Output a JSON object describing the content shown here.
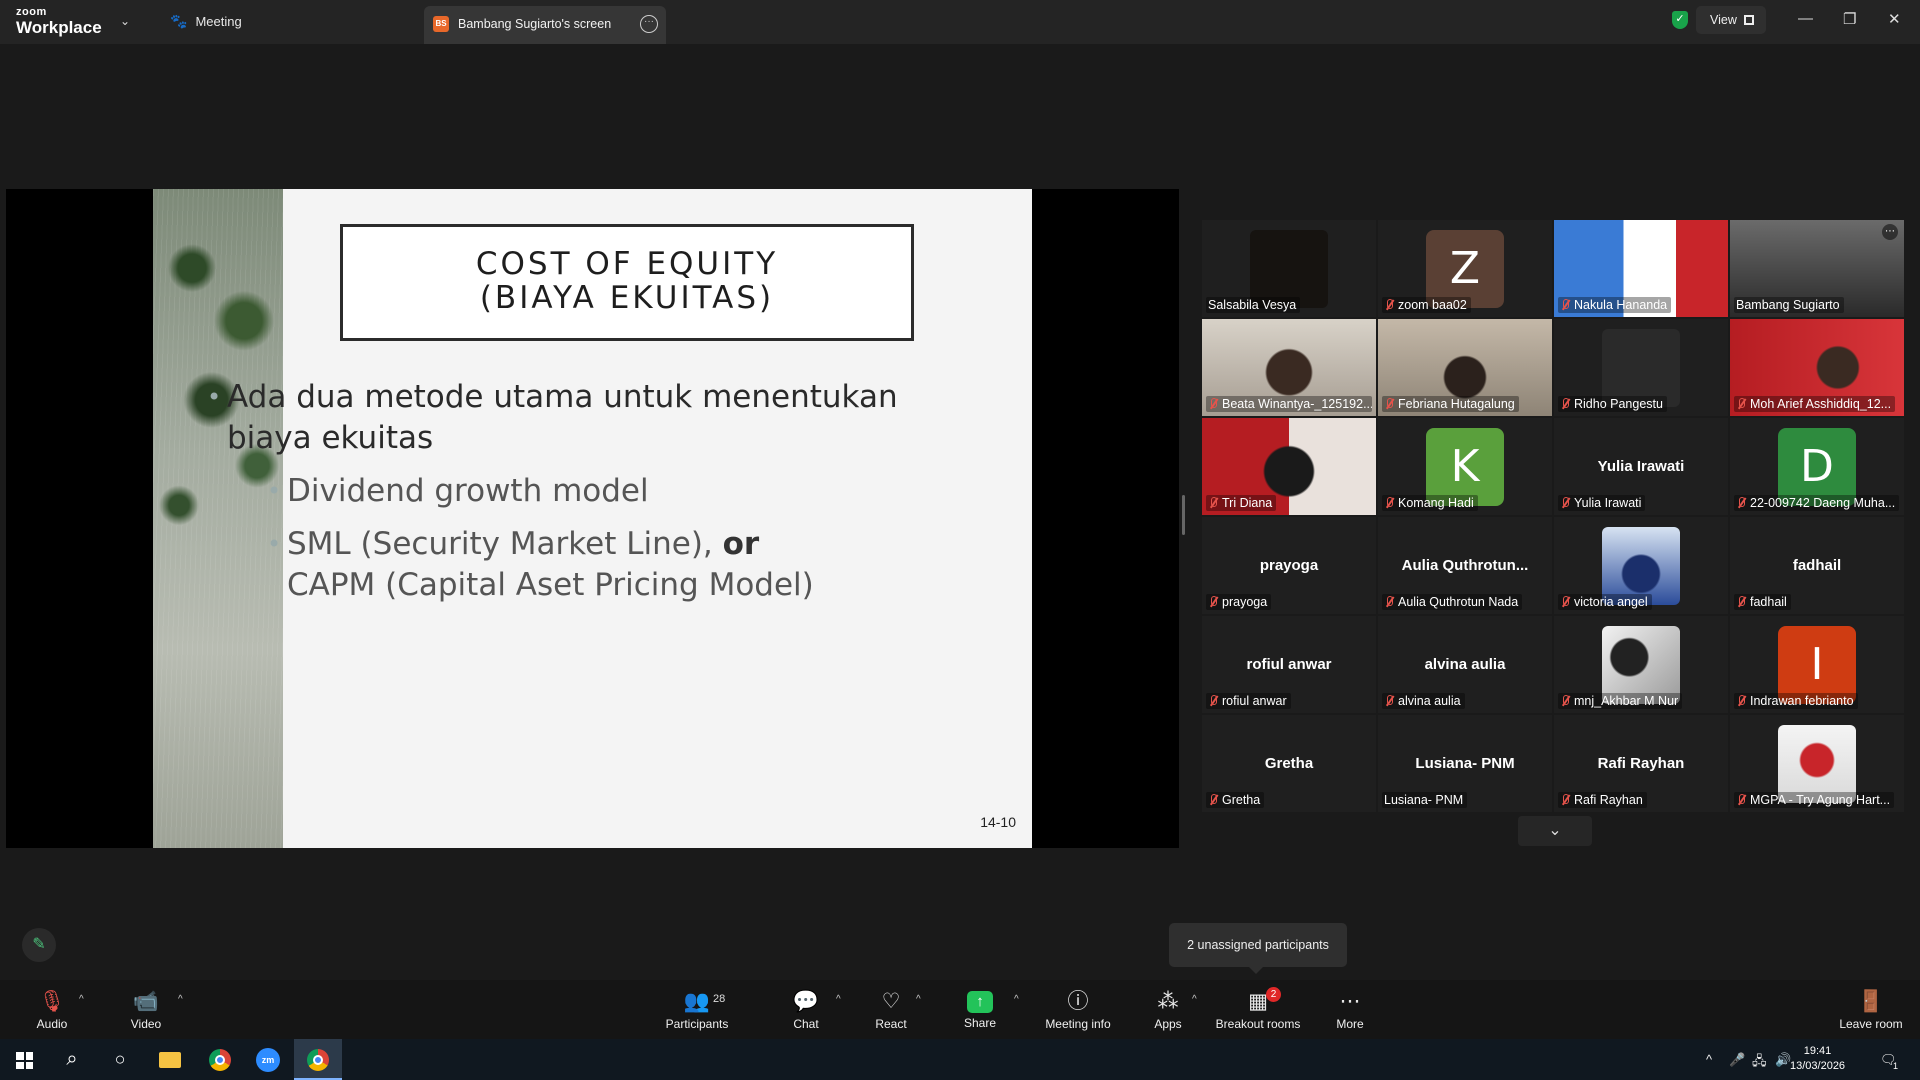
{
  "titlebar": {
    "logo_small": "zoom",
    "logo_big": "Workplace",
    "meeting_label": "Meeting",
    "tab_initials": "BS",
    "tab_title": "Bambang Sugiarto's screen",
    "view_label": "View",
    "shield_color": "#19a34a"
  },
  "slide": {
    "title_line1": "COST OF EQUITY",
    "title_line2": "(BIAYA EKUITAS)",
    "bullet_main": "Ada dua metode utama untuk menentukan biaya ekuitas",
    "sub1": "Dividend growth model",
    "sub2_part1": "SML (Security Market Line),",
    "sub2_bold": "or",
    "sub2_part2": "CAPM (Capital Aset Pricing Model)",
    "page_number": "14-10"
  },
  "participants": [
    {
      "label": "Salsabila Vesya",
      "muted": false,
      "kind": "dark"
    },
    {
      "label": "zoom baa02",
      "muted": true,
      "kind": "letter",
      "letter": "Z",
      "color": "#5a4034"
    },
    {
      "label": "Nakula Hananda",
      "muted": true,
      "kind": "photo"
    },
    {
      "label": "Bambang Sugiarto",
      "muted": false,
      "kind": "photo",
      "active": true
    },
    {
      "label": "Beata Winantya-_125192...",
      "muted": true,
      "kind": "photo"
    },
    {
      "label": "Febriana Hutagalung",
      "muted": true,
      "kind": "photo"
    },
    {
      "label": "Ridho Pangestu",
      "muted": true,
      "kind": "dark"
    },
    {
      "label": "Moh Arief Asshiddiq_12...",
      "muted": true,
      "kind": "photo"
    },
    {
      "label": "Tri Diana",
      "muted": true,
      "kind": "photo"
    },
    {
      "label": "Komang Hadi",
      "muted": true,
      "kind": "letter",
      "letter": "K",
      "color": "#5aa03c"
    },
    {
      "label": "Yulia Irawati",
      "muted": true,
      "kind": "name",
      "name": "Yulia Irawati"
    },
    {
      "label": "22-009742 Daeng Muha...",
      "muted": true,
      "kind": "letter",
      "letter": "D",
      "color": "#2e8b3e"
    },
    {
      "label": "prayoga",
      "muted": true,
      "kind": "name",
      "name": "prayoga"
    },
    {
      "label": "Aulia Quthrotun Nada",
      "muted": true,
      "kind": "name",
      "name": "Aulia  Quthrotun..."
    },
    {
      "label": "victoria angel",
      "muted": true,
      "kind": "thumb"
    },
    {
      "label": "fadhail",
      "muted": true,
      "kind": "name",
      "name": "fadhail"
    },
    {
      "label": "rofiul anwar",
      "muted": true,
      "kind": "name",
      "name": "rofiul anwar"
    },
    {
      "label": "alvina aulia",
      "muted": true,
      "kind": "name",
      "name": "alvina aulia"
    },
    {
      "label": "mnj_Akhbar M Nur",
      "muted": true,
      "kind": "thumb"
    },
    {
      "label": "Indrawan febrianto",
      "muted": true,
      "kind": "letter",
      "letter": "I",
      "color": "#cf3c12"
    },
    {
      "label": "Gretha",
      "muted": true,
      "kind": "name",
      "name": "Gretha"
    },
    {
      "label": "Lusiana- PNM",
      "muted": false,
      "kind": "name",
      "name": "Lusiana- PNM"
    },
    {
      "label": "Rafi Rayhan",
      "muted": true,
      "kind": "name",
      "name": "Rafi Rayhan"
    },
    {
      "label": "MGPA - Try Agung Hart...",
      "muted": true,
      "kind": "thumb"
    }
  ],
  "tooltip": "2 unassigned participants",
  "toolbar": {
    "audio": "Audio",
    "video": "Video",
    "participants": "Participants",
    "participants_count": "28",
    "chat": "Chat",
    "react": "React",
    "share": "Share",
    "meeting_info": "Meeting info",
    "apps": "Apps",
    "breakout": "Breakout rooms",
    "breakout_badge": "2",
    "more": "More",
    "leave": "Leave room"
  },
  "taskbar": {
    "time": "19:41",
    "date": "13/03/2026",
    "notif_count": "1"
  }
}
